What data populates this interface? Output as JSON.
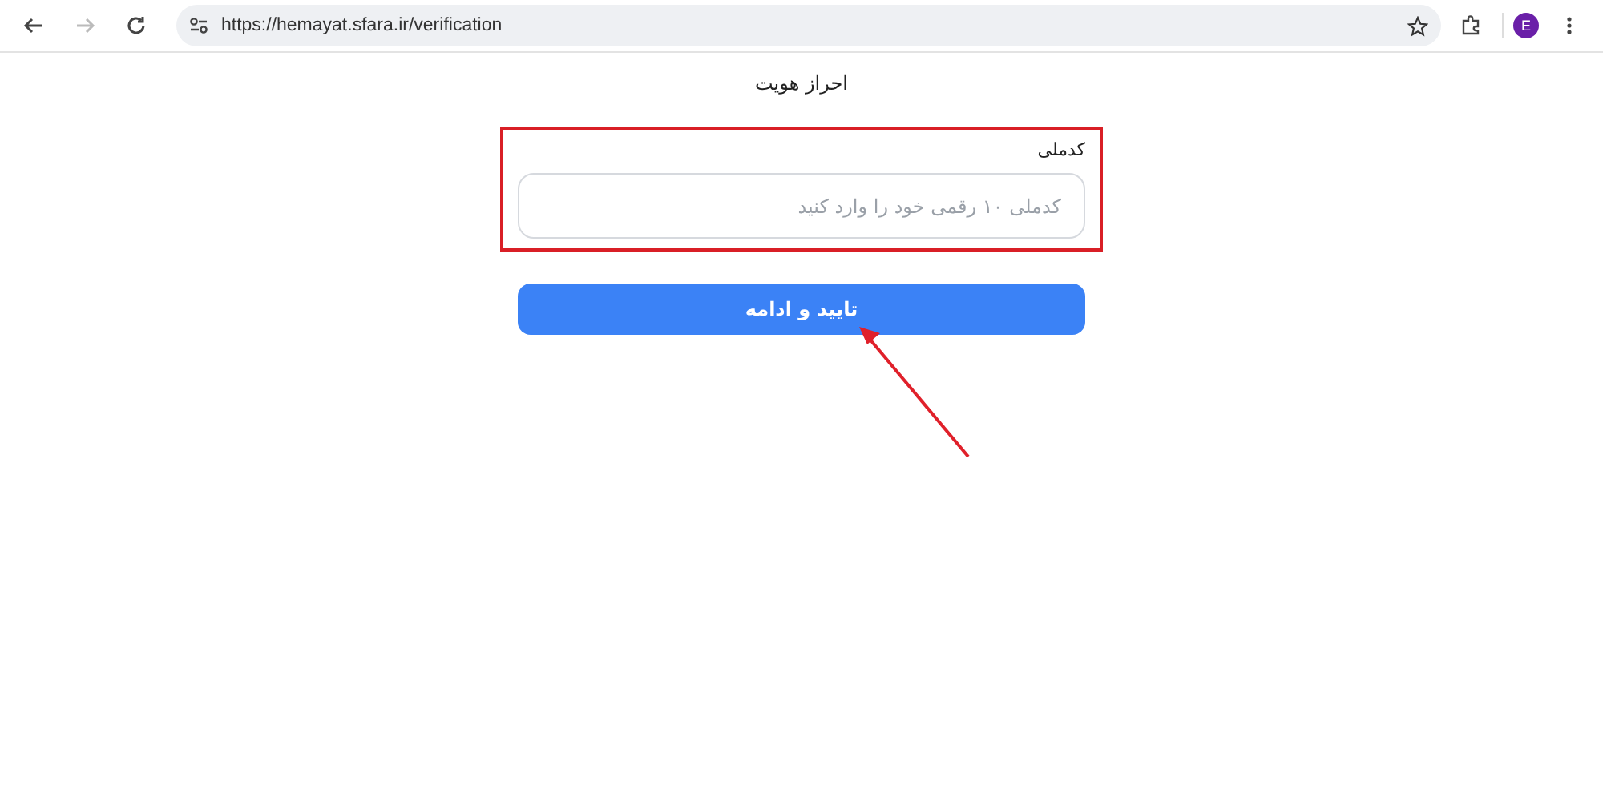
{
  "browser": {
    "url": "https://hemayat.sfara.ir/verification",
    "profile_initial": "E",
    "back_disabled": false,
    "forward_disabled": true
  },
  "page": {
    "title": "احراز هویت",
    "field": {
      "label": "کدملی",
      "placeholder": "کدملی ۱۰ رقمی خود را وارد کنید",
      "highlighted": true
    },
    "button": {
      "label": "تایید و ادامه",
      "pointed_at": true
    }
  }
}
